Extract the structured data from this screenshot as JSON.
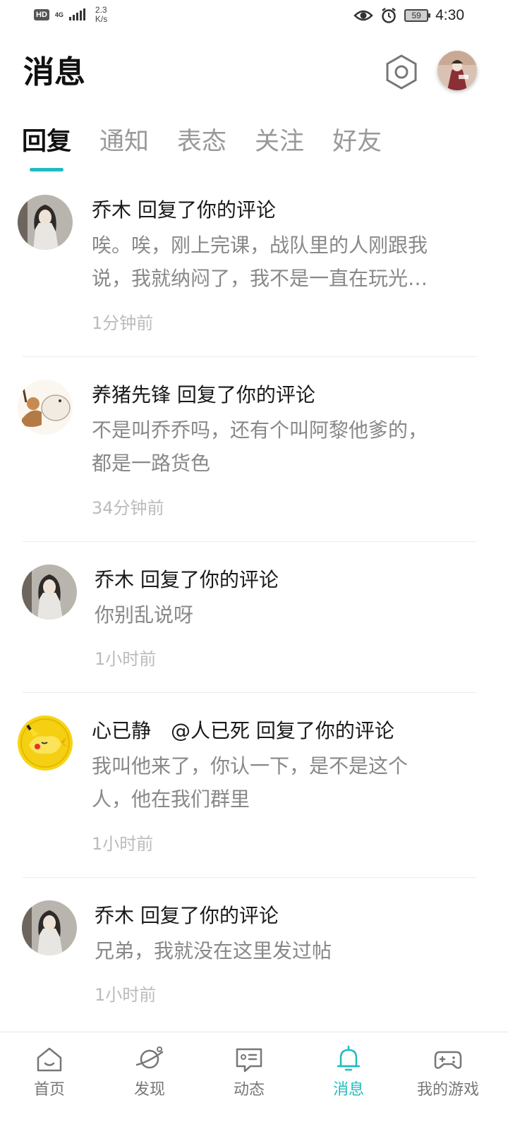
{
  "status_bar": {
    "hd": "HD",
    "network": "4G",
    "speed_value": "2.3",
    "speed_unit": "K/s",
    "battery": "59",
    "time": "4:30",
    "icons": [
      "eye-icon",
      "alarm-icon"
    ]
  },
  "header": {
    "title": "消息"
  },
  "tabs": [
    {
      "label": "回复",
      "active": true
    },
    {
      "label": "通知",
      "active": false
    },
    {
      "label": "表态",
      "active": false
    },
    {
      "label": "关注",
      "active": false
    },
    {
      "label": "好友",
      "active": false
    }
  ],
  "messages": [
    {
      "title": "乔木 回复了你的评论",
      "body_lines": [
        "唉。唉，刚上完课，战队里的人刚跟我",
        "说，我就纳闷了，我不是一直在玩光…"
      ],
      "time": "1分钟前"
    },
    {
      "title": "养猪先锋 回复了你的评论",
      "body_lines": [
        "不是叫乔乔吗，还有个叫阿黎他爹的，",
        "都是一路货色"
      ],
      "time": "34分钟前"
    },
    {
      "title": "乔木 回复了你的评论",
      "body_lines": [
        "你别乱说呀"
      ],
      "time": "1小时前"
    },
    {
      "title": "心已静　@人已死 回复了你的评论",
      "body_lines": [
        "我叫他来了，你认一下，是不是这个",
        "人，他在我们群里"
      ],
      "time": "1小时前"
    },
    {
      "title": "乔木 回复了你的评论",
      "body_lines": [
        "兄弟，我就没在这里发过帖"
      ],
      "time": "1小时前"
    }
  ],
  "bottom_nav": [
    {
      "label": "首页",
      "icon": "home-icon",
      "active": false
    },
    {
      "label": "发现",
      "icon": "planet-icon",
      "active": false
    },
    {
      "label": "动态",
      "icon": "message-card-icon",
      "active": false
    },
    {
      "label": "消息",
      "icon": "bell-icon",
      "active": true
    },
    {
      "label": "我的游戏",
      "icon": "gamepad-icon",
      "active": false
    }
  ],
  "colors": {
    "accent": "#1fbcbf",
    "muted_text": "#888888",
    "time_text": "#bbbbbb"
  }
}
